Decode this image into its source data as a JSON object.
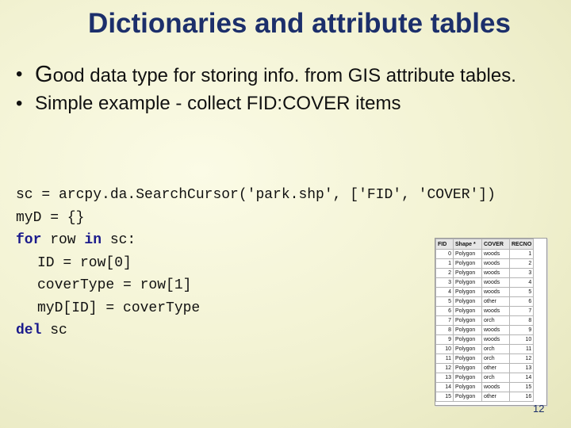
{
  "title": "Dictionaries and attribute tables",
  "bullets": [
    {
      "first_letter": "G",
      "rest": "ood data type for storing info. from GIS attribute tables."
    },
    {
      "first_letter": "S",
      "rest": "imple example - collect FID:COVER items"
    }
  ],
  "bullet_glyph": "•",
  "code": {
    "line1": "sc = arcpy.da.SearchCursor('park.shp', ['FID', 'COVER'])",
    "line2": "myD = {}",
    "line3_kw1": "for",
    "line3_mid": " row ",
    "line3_kw2": "in",
    "line3_rest": " sc:",
    "line4": "ID = row[0]",
    "line5": "coverType = row[1]",
    "line6": "myD[ID] = coverType",
    "line7_kw": "del",
    "line7_rest": " sc"
  },
  "attribute_table": {
    "headers": [
      "FID",
      "Shape *",
      "COVER",
      "RECNO"
    ],
    "rows": [
      [
        "0",
        "Polygon",
        "woods",
        "1"
      ],
      [
        "1",
        "Polygon",
        "woods",
        "2"
      ],
      [
        "2",
        "Polygon",
        "woods",
        "3"
      ],
      [
        "3",
        "Polygon",
        "woods",
        "4"
      ],
      [
        "4",
        "Polygon",
        "woods",
        "5"
      ],
      [
        "5",
        "Polygon",
        "other",
        "6"
      ],
      [
        "6",
        "Polygon",
        "woods",
        "7"
      ],
      [
        "7",
        "Polygon",
        "orch",
        "8"
      ],
      [
        "8",
        "Polygon",
        "woods",
        "9"
      ],
      [
        "9",
        "Polygon",
        "woods",
        "10"
      ],
      [
        "10",
        "Polygon",
        "orch",
        "11"
      ],
      [
        "11",
        "Polygon",
        "orch",
        "12"
      ],
      [
        "12",
        "Polygon",
        "other",
        "13"
      ],
      [
        "13",
        "Polygon",
        "orch",
        "14"
      ],
      [
        "14",
        "Polygon",
        "woods",
        "15"
      ],
      [
        "15",
        "Polygon",
        "other",
        "16"
      ]
    ]
  },
  "page_number": "12",
  "colors": {
    "title": "#1c2f6b",
    "keyword": "#1a1a8c",
    "background": "#f2f2d2"
  }
}
